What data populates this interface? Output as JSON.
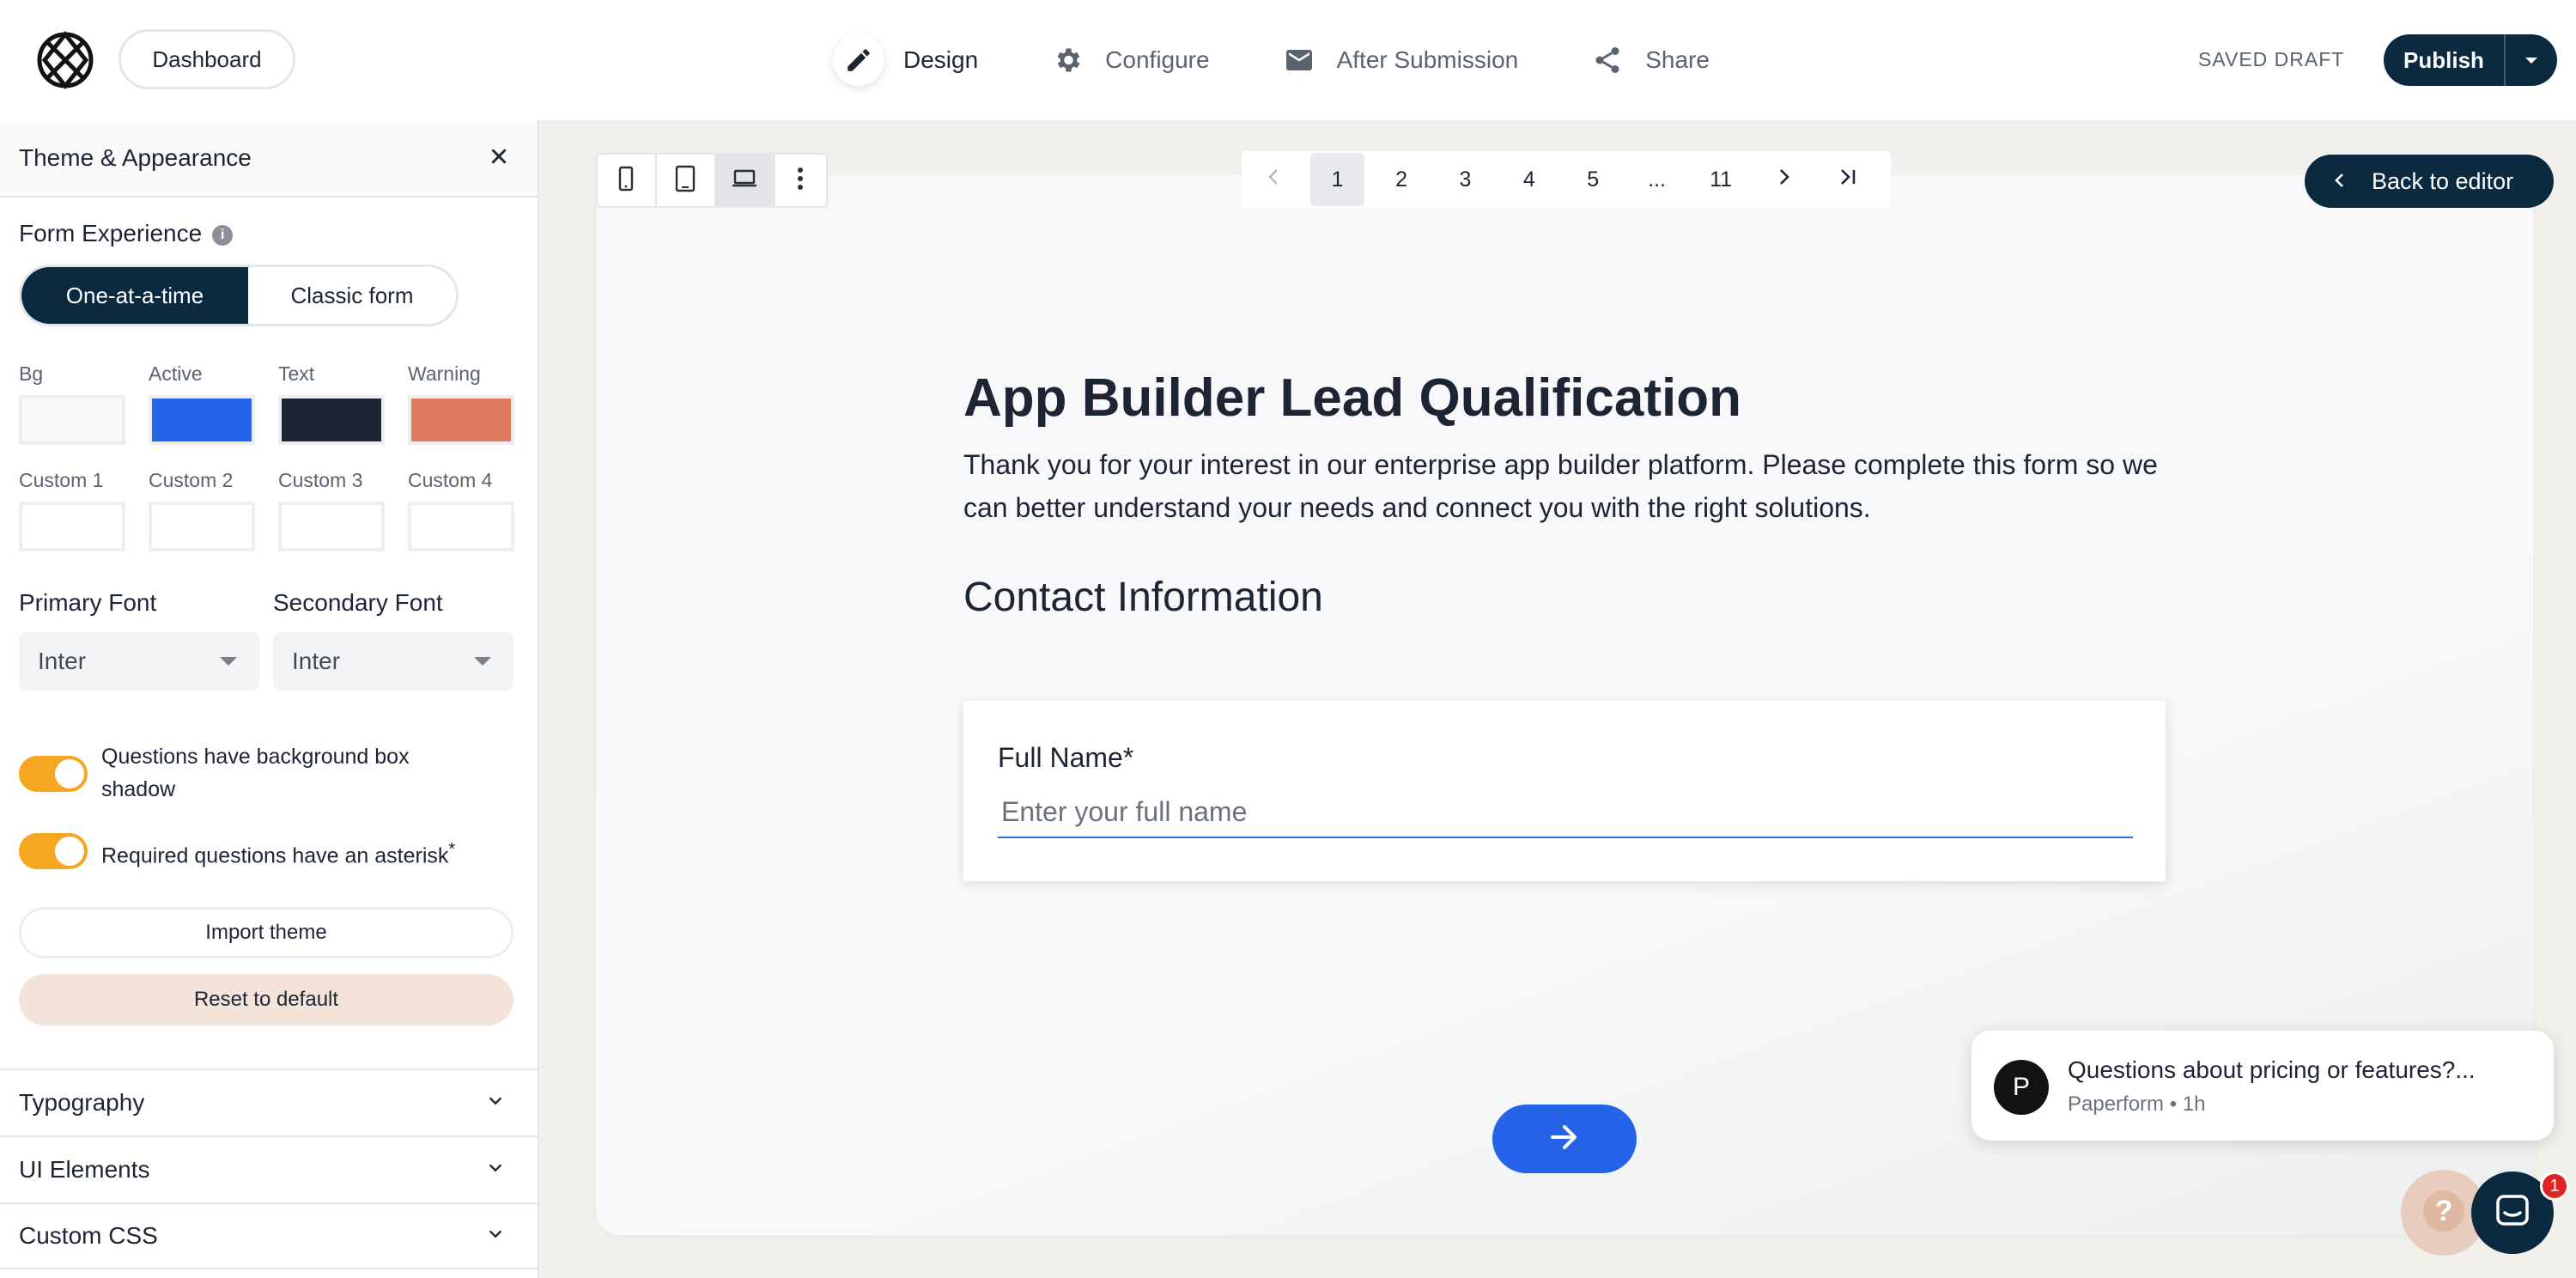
{
  "header": {
    "dashboard_label": "Dashboard",
    "nav": [
      {
        "label": "Design",
        "icon": "pencil-icon"
      },
      {
        "label": "Configure",
        "icon": "gear-icon"
      },
      {
        "label": "After Submission",
        "icon": "envelope-icon"
      },
      {
        "label": "Share",
        "icon": "share-icon"
      }
    ],
    "status": "SAVED DRAFT",
    "publish_label": "Publish"
  },
  "sidebar": {
    "title": "Theme & Appearance",
    "form_experience": {
      "label": "Form Experience",
      "options": [
        "One-at-a-time",
        "Classic form"
      ],
      "selected": "One-at-a-time"
    },
    "swatches": [
      {
        "label": "Bg",
        "color": "#f8f9fb"
      },
      {
        "label": "Active",
        "color": "#2563e8"
      },
      {
        "label": "Text",
        "color": "#1d2433"
      },
      {
        "label": "Warning",
        "color": "#e07a5f"
      },
      {
        "label": "Custom 1",
        "color": "#ffffff"
      },
      {
        "label": "Custom 2",
        "color": "#ffffff"
      },
      {
        "label": "Custom 3",
        "color": "#ffffff"
      },
      {
        "label": "Custom 4",
        "color": "#ffffff"
      }
    ],
    "fonts": {
      "primary_label": "Primary Font",
      "primary_value": "Inter",
      "secondary_label": "Secondary Font",
      "secondary_value": "Inter"
    },
    "toggles": [
      {
        "label": "Questions have background box shadow",
        "on": true
      },
      {
        "label": "Required questions have an asterisk",
        "suffix": "*",
        "on": true
      }
    ],
    "import_label": "Import theme",
    "reset_label": "Reset to default",
    "accordions": [
      "Typography",
      "UI Elements",
      "Custom CSS"
    ]
  },
  "pager": {
    "pages": [
      "1",
      "2",
      "3",
      "4",
      "5",
      "...",
      "11"
    ],
    "current": "1"
  },
  "back_label": "Back to editor",
  "form": {
    "title": "App Builder Lead Qualification",
    "description": "Thank you for your interest in our enterprise app builder platform. Please complete this form so we can better understand your needs and connect you with the right solutions.",
    "section": "Contact Information",
    "question_label": "Full Name*",
    "question_placeholder": "Enter your full name"
  },
  "chat": {
    "avatar_letter": "P",
    "message": "Questions about pricing or features?...",
    "meta": "Paperform • 1h",
    "badge_count": "1"
  },
  "colors": {
    "brand_dark": "#0b2a3f",
    "accent_blue": "#2563e8",
    "toggle_on": "#f5a623"
  }
}
